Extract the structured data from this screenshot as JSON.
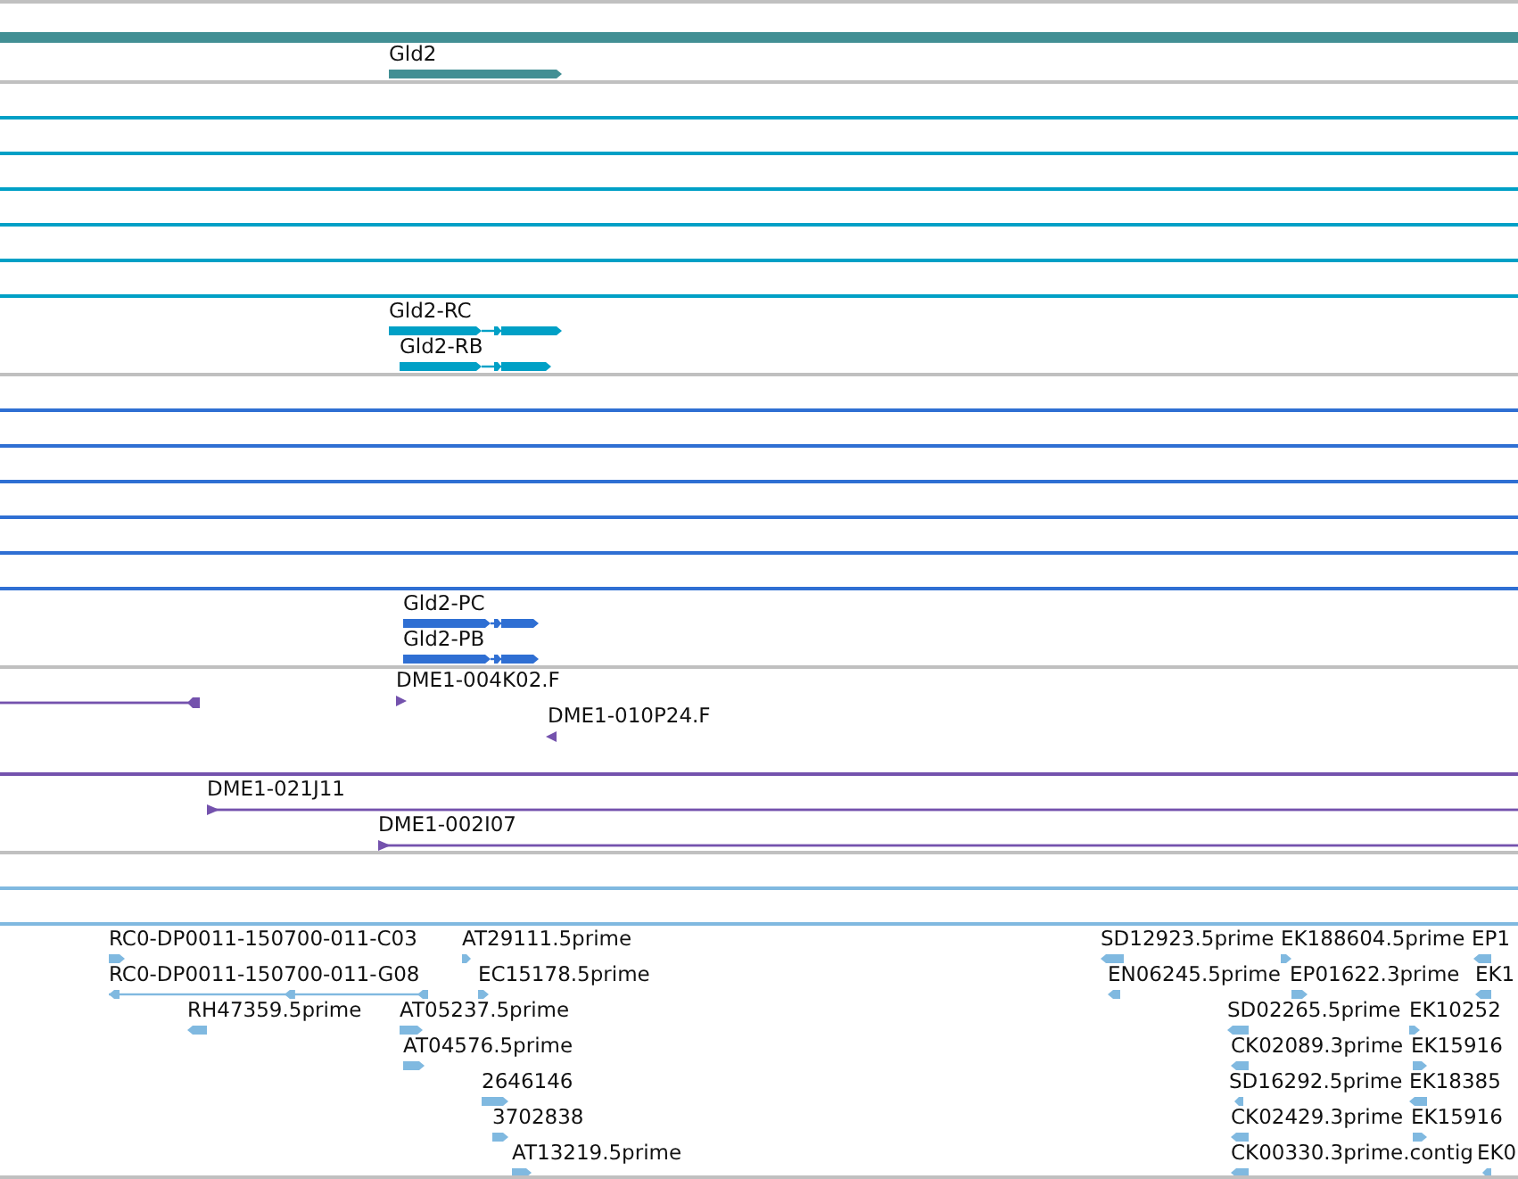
{
  "tracks": [
    {
      "kind": "gene",
      "color": "#428f94",
      "features": [
        {
          "kind": "span"
        },
        {
          "kind": "gene",
          "label": "Gld2",
          "reverse": false
        }
      ]
    },
    {
      "kind": "transcript",
      "color": "#00a0c6",
      "features": [
        {
          "kind": "span"
        },
        {
          "kind": "span"
        },
        {
          "kind": "span"
        },
        {
          "kind": "span"
        },
        {
          "kind": "span"
        },
        {
          "kind": "span"
        },
        {
          "kind": "transcript",
          "label": "Gld2-RC",
          "reverse": false
        },
        {
          "kind": "transcript",
          "label": "Gld2-RB",
          "reverse": false
        }
      ]
    },
    {
      "kind": "protein",
      "color": "#2f6fd3",
      "features": [
        {
          "kind": "span"
        },
        {
          "kind": "span"
        },
        {
          "kind": "span"
        },
        {
          "kind": "span"
        },
        {
          "kind": "span"
        },
        {
          "kind": "span"
        },
        {
          "kind": "transcript",
          "label": "Gld2-PC",
          "reverse": false
        },
        {
          "kind": "transcript",
          "label": "Gld2-PB",
          "reverse": false
        }
      ]
    },
    {
      "kind": "clone",
      "color": "#7452ad",
      "features": [
        {
          "kind": "clone",
          "reverse": true
        },
        {
          "kind": "read",
          "label": "DME1-004K02.F",
          "reverse": false
        },
        {
          "kind": "read",
          "label": "DME1-010P24.F",
          "reverse": true
        },
        {
          "kind": "span"
        },
        {
          "kind": "clone",
          "label": "DME1-021J11",
          "reverse": false
        },
        {
          "kind": "clone",
          "label": "DME1-002I07",
          "reverse": false
        }
      ]
    },
    {
      "kind": "est",
      "color": "#80b9e0",
      "features": [
        {
          "kind": "span"
        },
        {
          "kind": "span"
        },
        {
          "kind": "est",
          "label": "RC0-DP0011-150700-011-C03",
          "reverse": false
        },
        {
          "kind": "est",
          "label": "AT29111.5prime",
          "reverse": false
        },
        {
          "kind": "est",
          "label": "SD12923.5prime",
          "reverse": true
        },
        {
          "kind": "est",
          "label": "EK188604.5prime",
          "reverse": false
        },
        {
          "kind": "est",
          "label": "EP1",
          "reverse": true
        },
        {
          "kind": "est",
          "label": "RC0-DP0011-150700-011-G08",
          "reverse": true
        },
        {
          "kind": "est",
          "label": "EC15178.5prime",
          "reverse": false
        },
        {
          "kind": "est",
          "label": "EN06245.5prime",
          "reverse": true
        },
        {
          "kind": "est",
          "label": "EP01622.3prime",
          "reverse": false
        },
        {
          "kind": "est",
          "label": "EK1",
          "reverse": true
        },
        {
          "kind": "est",
          "label": "RH47359.5prime",
          "reverse": true
        },
        {
          "kind": "est",
          "label": "AT05237.5prime",
          "reverse": false
        },
        {
          "kind": "est",
          "label": "SD02265.5prime",
          "reverse": true
        },
        {
          "kind": "est",
          "label": "EK10252",
          "reverse": false
        },
        {
          "kind": "est",
          "label": "AT04576.5prime",
          "reverse": false
        },
        {
          "kind": "est",
          "label": "CK02089.3prime",
          "reverse": true
        },
        {
          "kind": "est",
          "label": "EK15916",
          "reverse": false
        },
        {
          "kind": "est",
          "label": "2646146",
          "reverse": false
        },
        {
          "kind": "est",
          "label": "SD16292.5prime",
          "reverse": true
        },
        {
          "kind": "est",
          "label": "EK18385",
          "reverse": true
        },
        {
          "kind": "est",
          "label": "3702838",
          "reverse": false
        },
        {
          "kind": "est",
          "label": "CK02429.3prime",
          "reverse": true
        },
        {
          "kind": "est",
          "label": "EK15916",
          "reverse": false
        },
        {
          "kind": "est",
          "label": "AT13219.5prime",
          "reverse": false
        },
        {
          "kind": "est",
          "label": "CK00330.3prime.contig",
          "reverse": true
        },
        {
          "kind": "est",
          "label": "EK0",
          "reverse": true
        }
      ]
    }
  ]
}
